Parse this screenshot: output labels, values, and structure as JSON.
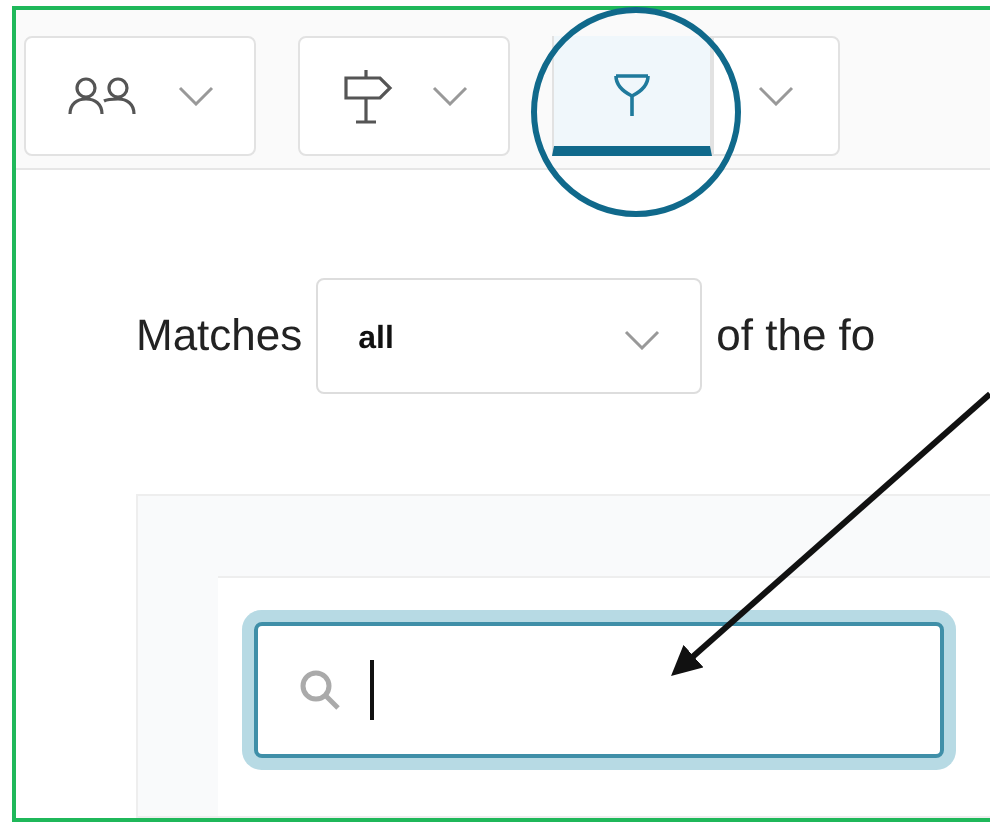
{
  "toolbar": {
    "items": [
      {
        "kind": "people",
        "caret": true,
        "selected": false
      },
      {
        "kind": "signpost",
        "caret": true,
        "selected": false
      },
      {
        "kind": "filter",
        "caret": false,
        "selected": true
      },
      {
        "kind": "caret",
        "caret": true,
        "selected": false
      }
    ]
  },
  "match_rule": {
    "label": "Matches",
    "value": "all",
    "suffix": "of the fo"
  },
  "search": {
    "focused": true
  }
}
